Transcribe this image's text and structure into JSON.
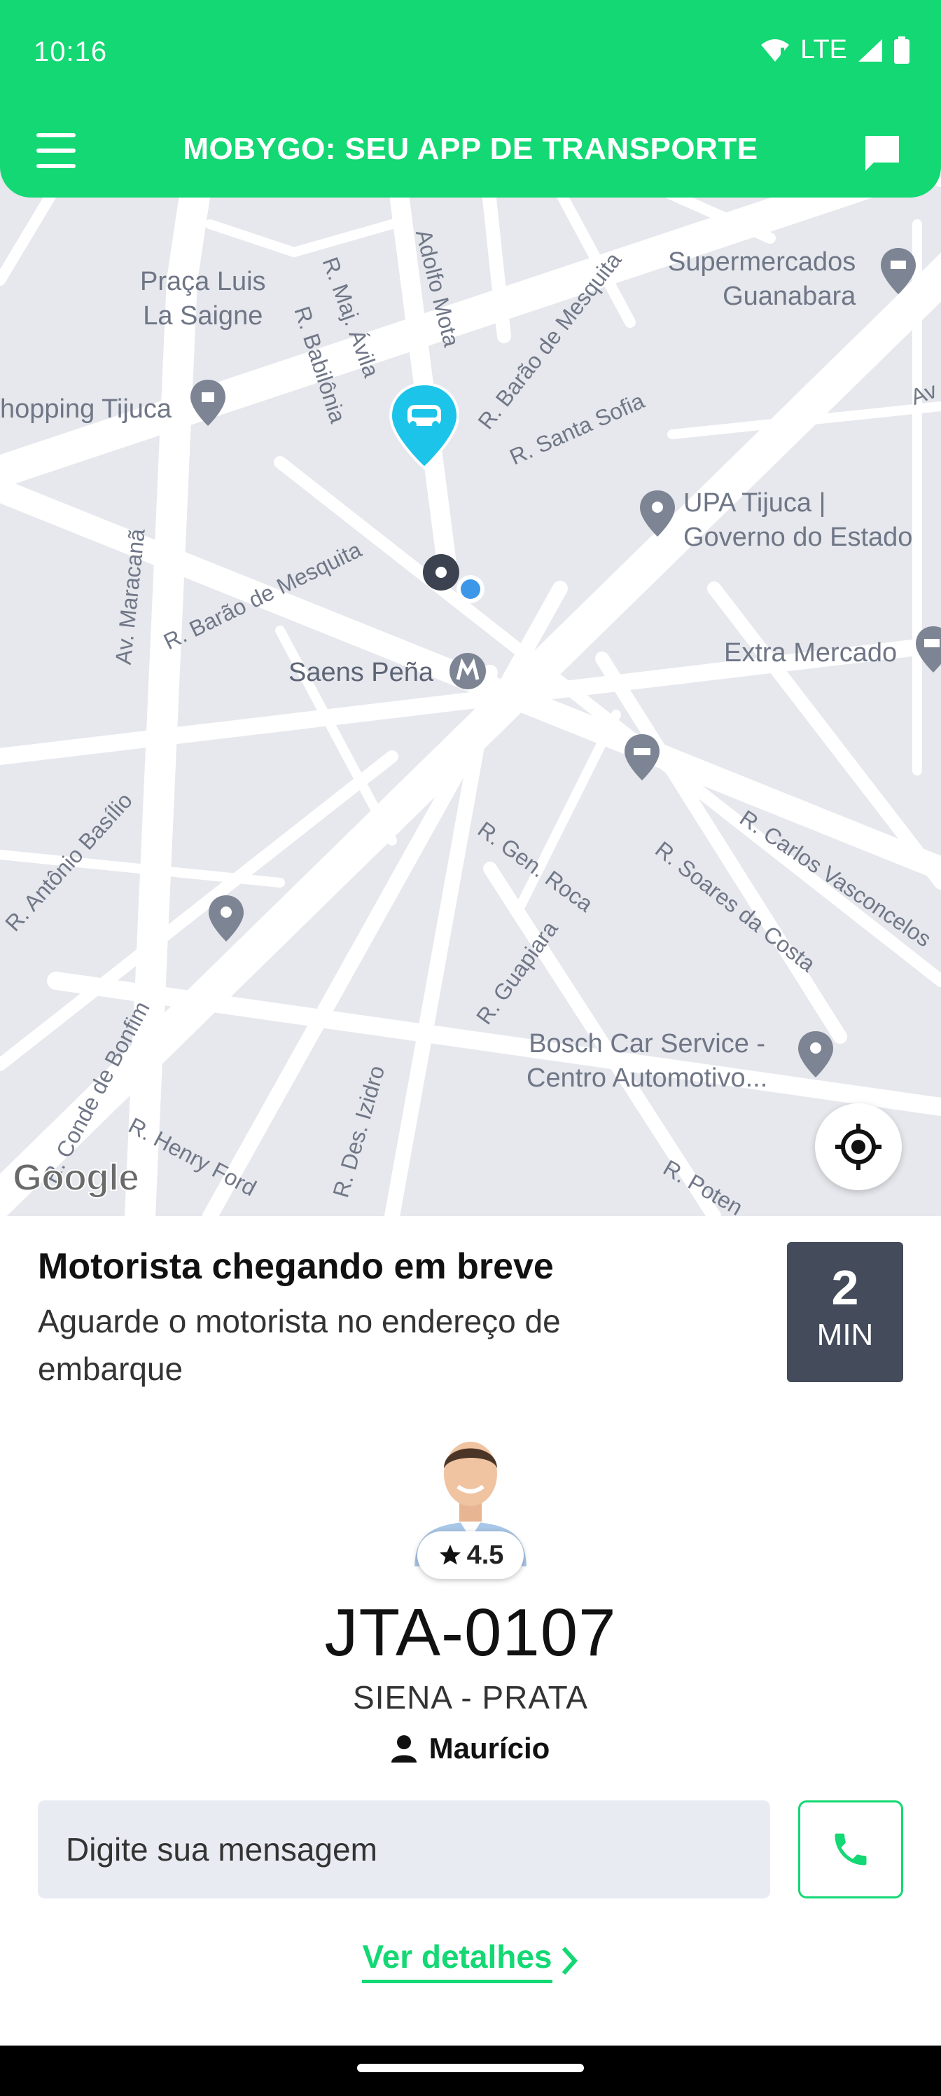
{
  "status_bar": {
    "time": "10:16",
    "network": "LTE"
  },
  "header": {
    "title": "MOBYGO: SEU APP DE TRANSPORTE"
  },
  "map": {
    "places": [
      {
        "text": "Praça Luis\nLa Saigne"
      },
      {
        "text": "Supermercados\nGuanabara"
      },
      {
        "text": "hopping Tijuca"
      },
      {
        "text": "UPA Tijuca |\nGoverno do Estado"
      },
      {
        "text": "Extra Mercado"
      },
      {
        "text": "Saens Peña"
      },
      {
        "text": "Bosch Car Service -\nCentro Automotivo..."
      }
    ],
    "streets": [
      "R. Maj. Ávila",
      "Adolfo Mota",
      "R. Babilônia",
      "R. Barão de Mesquita",
      "R. Santa Sofia",
      "Av",
      "R. Barão de Mesquita",
      "Av. Maracanã",
      "R. Antônio Basílio",
      "R. Gen. Roca",
      "R. Soares da Costa",
      "R. Carlos Vasconcelos",
      "R. Guapiara",
      "R. Conde de Bonfim",
      "R. Henry Ford",
      "R. Des. Izidro",
      "R. Poten"
    ],
    "attribution": "Google"
  },
  "trip": {
    "title": "Motorista chegando em breve",
    "subtitle": "Aguarde o motorista no endereço de embarque",
    "eta_value": "2",
    "eta_unit": "MIN"
  },
  "driver": {
    "rating": "4.5",
    "plate": "JTA-0107",
    "vehicle": "SIENA - PRATA",
    "name": "Maurício"
  },
  "chat": {
    "placeholder": "Digite sua mensagem"
  },
  "details_link": "Ver detalhes",
  "colors": {
    "brand": "#13d873",
    "eta_bg": "#444b5a",
    "map_bg": "#e6e8ed",
    "car_pin": "#1bc4e8"
  }
}
